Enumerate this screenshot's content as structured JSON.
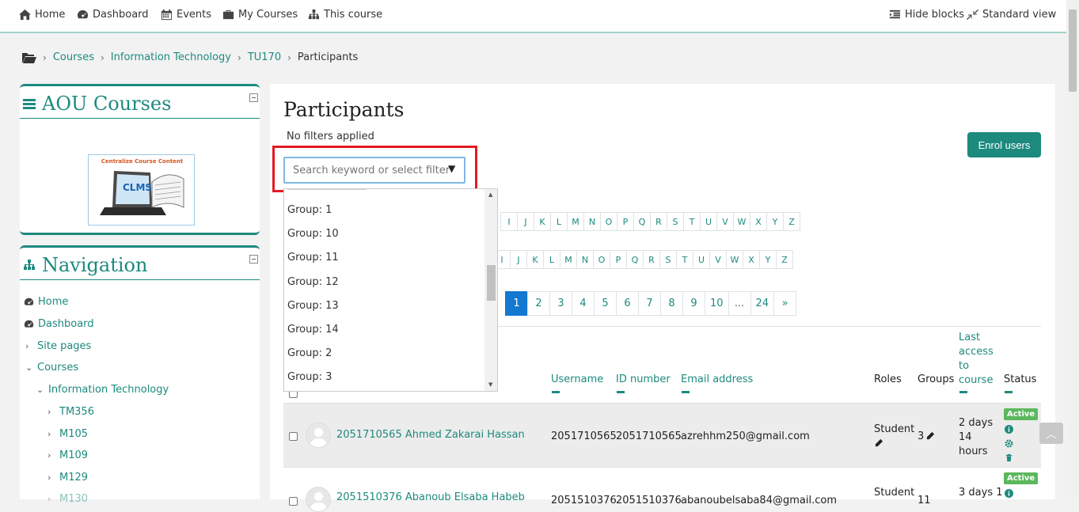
{
  "navbar": {
    "items": [
      {
        "label": "Home",
        "icon": "home-icon"
      },
      {
        "label": "Dashboard",
        "icon": "dashboard-icon"
      },
      {
        "label": "Events",
        "icon": "calendar-icon"
      },
      {
        "label": "My Courses",
        "icon": "briefcase-icon"
      },
      {
        "label": "This course",
        "icon": "sitemap-icon"
      }
    ],
    "hide_blocks": "Hide blocks",
    "standard_view": "Standard view"
  },
  "breadcrumb": {
    "items": [
      "Courses",
      "Information Technology",
      "TU170",
      "Participants"
    ]
  },
  "aou_block": {
    "title": "AOU Courses",
    "logo_caption": "Centralize Course Content",
    "logo_text": "CLMS"
  },
  "nav_block": {
    "title": "Navigation",
    "items": [
      {
        "label": "Home"
      },
      {
        "label": "Dashboard"
      },
      {
        "label": "Site pages"
      },
      {
        "label": "Courses"
      },
      {
        "label": "Information Technology"
      },
      {
        "label": "TM356"
      },
      {
        "label": "M105"
      },
      {
        "label": "M109"
      },
      {
        "label": "M129"
      },
      {
        "label": "M130"
      }
    ]
  },
  "main": {
    "title": "Participants",
    "no_filters": "No filters applied",
    "enrol_label": "Enrol users",
    "search_placeholder": "Search keyword or select filter",
    "dropdown_options": [
      "Group: 1",
      "Group: 10",
      "Group: 11",
      "Group: 12",
      "Group: 13",
      "Group: 14",
      "Group: 2",
      "Group: 3"
    ],
    "letters_first": [
      "I",
      "J",
      "K",
      "L",
      "M",
      "N",
      "O",
      "P",
      "Q",
      "R",
      "S",
      "T",
      "U",
      "V",
      "W",
      "X",
      "Y",
      "Z"
    ],
    "letters_last": [
      "I",
      "J",
      "K",
      "L",
      "M",
      "N",
      "O",
      "P",
      "Q",
      "R",
      "S",
      "T",
      "U",
      "V",
      "W",
      "X",
      "Y",
      "Z"
    ],
    "pages": [
      "1",
      "2",
      "3",
      "4",
      "5",
      "6",
      "7",
      "8",
      "9",
      "10",
      "...",
      "24",
      "»"
    ],
    "columns": {
      "username": "Username",
      "id_number": "ID number",
      "email": "Email address",
      "roles": "Roles",
      "groups": "Groups",
      "last_access": [
        "Last",
        "access",
        "to",
        "course"
      ],
      "status": "Status"
    },
    "rows": [
      {
        "name": "2051710565 Ahmed Zakarai Hassan",
        "username": "2051710565",
        "id": "2051710565",
        "email": "azrehhm250@gmail.com",
        "role": "Student",
        "groups": "3",
        "last_access": [
          "2 days",
          "14",
          "hours"
        ],
        "status": "Active"
      },
      {
        "name": "2051510376 Abanoub Elsaba Habeb",
        "username": "2051510376",
        "id": "2051510376",
        "email": "abanoubelsaba84@gmail.com",
        "role": "Student",
        "groups": "11",
        "last_access": [
          "3 days 1"
        ],
        "status": "Active"
      }
    ]
  }
}
